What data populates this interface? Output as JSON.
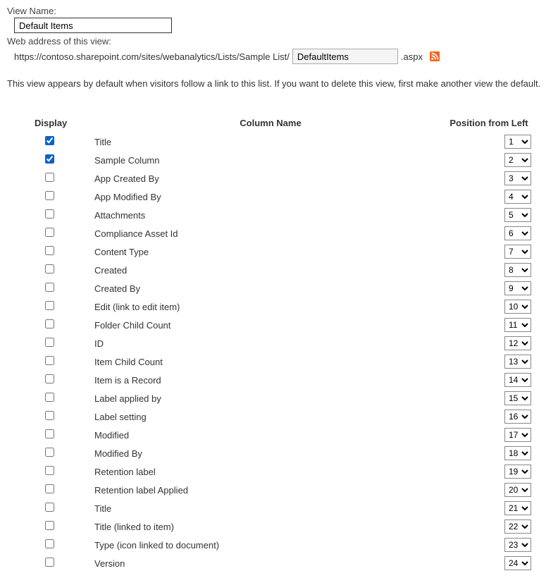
{
  "view_name_label": "View Name:",
  "view_name_value": "Default Items",
  "web_address_label": "Web address of this view:",
  "url_prefix": "https://contoso.sharepoint.com/sites/webanalytics/Lists/Sample List/",
  "url_slug": "DefaultItems",
  "url_suffix": ".aspx",
  "description": "This view appears by default when visitors follow a link to this list. If you want to delete this view, first make another view the default.",
  "headers": {
    "display": "Display",
    "column_name": "Column Name",
    "position": "Position from Left"
  },
  "columns": [
    {
      "name": "Title",
      "checked": true,
      "position": 1
    },
    {
      "name": "Sample Column",
      "checked": true,
      "position": 2
    },
    {
      "name": "App Created By",
      "checked": false,
      "position": 3
    },
    {
      "name": "App Modified By",
      "checked": false,
      "position": 4
    },
    {
      "name": "Attachments",
      "checked": false,
      "position": 5
    },
    {
      "name": "Compliance Asset Id",
      "checked": false,
      "position": 6
    },
    {
      "name": "Content Type",
      "checked": false,
      "position": 7
    },
    {
      "name": "Created",
      "checked": false,
      "position": 8
    },
    {
      "name": "Created By",
      "checked": false,
      "position": 9
    },
    {
      "name": "Edit (link to edit item)",
      "checked": false,
      "position": 10
    },
    {
      "name": "Folder Child Count",
      "checked": false,
      "position": 11
    },
    {
      "name": "ID",
      "checked": false,
      "position": 12
    },
    {
      "name": "Item Child Count",
      "checked": false,
      "position": 13
    },
    {
      "name": "Item is a Record",
      "checked": false,
      "position": 14
    },
    {
      "name": "Label applied by",
      "checked": false,
      "position": 15
    },
    {
      "name": "Label setting",
      "checked": false,
      "position": 16
    },
    {
      "name": "Modified",
      "checked": false,
      "position": 17
    },
    {
      "name": "Modified By",
      "checked": false,
      "position": 18
    },
    {
      "name": "Retention label",
      "checked": false,
      "position": 19
    },
    {
      "name": "Retention label Applied",
      "checked": false,
      "position": 20
    },
    {
      "name": "Title",
      "checked": false,
      "position": 21
    },
    {
      "name": "Title (linked to item)",
      "checked": false,
      "position": 22
    },
    {
      "name": "Type (icon linked to document)",
      "checked": false,
      "position": 23
    },
    {
      "name": "Version",
      "checked": false,
      "position": 24
    }
  ],
  "max_position": 24
}
